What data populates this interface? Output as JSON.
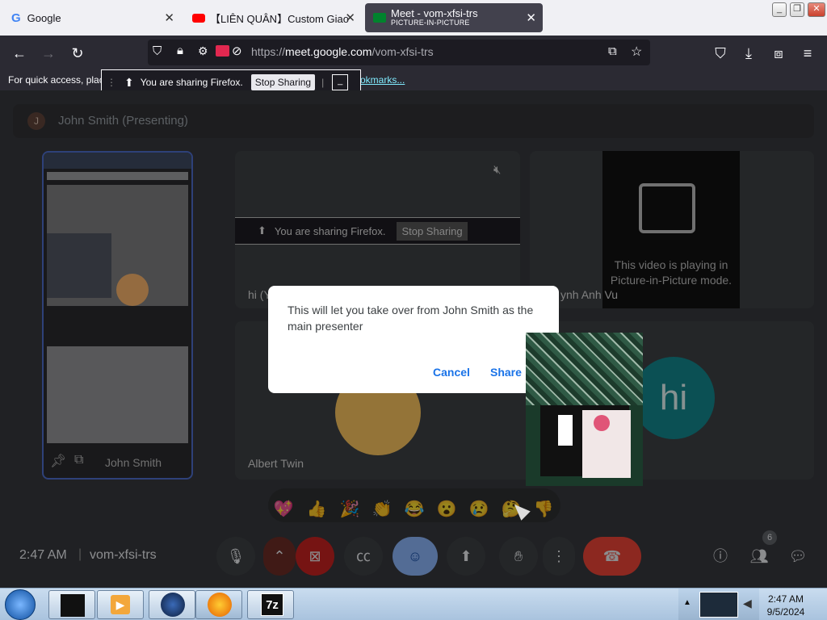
{
  "tabs": [
    {
      "title": "Google",
      "icon": "google-g-icon"
    },
    {
      "title": "【LIÊN QUÂN】Custom Giao H",
      "icon": "youtube-icon"
    },
    {
      "title": "Meet - vom-xfsi-trs",
      "subtitle": "PICTURE-IN-PICTURE",
      "icon": "meet-icon"
    }
  ],
  "url": {
    "scheme": "https://",
    "host": "meet.google.com",
    "path": "/vom-xfsi-trs"
  },
  "bookmarks": {
    "prefix": "For quick access, plac",
    "link": "okmarks..."
  },
  "sharing_bar": {
    "text": "You are sharing Firefox.",
    "stop": "Stop Sharing",
    "minimize": "_"
  },
  "meet": {
    "presenting_initial": "J",
    "presenting_label": "John Smith (Presenting)",
    "preview_name": "John Smith",
    "tile1_sharing_text": "You are sharing Firefox.",
    "tile1_stop": "Stop Sharing",
    "tile1_name": "hi (Y",
    "tile2_name": "ynh Anh Vu",
    "pip_message": "This video is playing in Picture-in-Picture mode.",
    "tile3_name": "Albert Twin",
    "tile4_avatar": "hi",
    "dialog": {
      "message": "This will let you take over from John Smith as the main presenter",
      "cancel": "Cancel",
      "share": "Share"
    },
    "emojis": [
      "💖",
      "👍",
      "🎉",
      "👏",
      "😂",
      "😮",
      "😢",
      "🤔",
      "👎"
    ],
    "time": "2:47 AM",
    "code": "vom-xfsi-trs",
    "people_count": "6"
  },
  "taskbar": {
    "time": "2:47 AM",
    "date": "9/5/2024",
    "seven_zip_label": "7z"
  },
  "colors": {
    "accent": "#1a73e8",
    "end_call": "#ea4335",
    "teal_avatar": "#12858c"
  }
}
